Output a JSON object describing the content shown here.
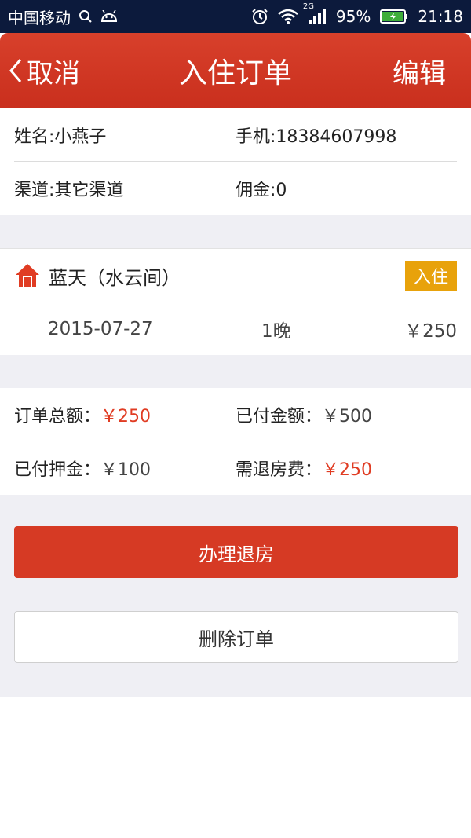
{
  "status_bar": {
    "carrier": "中国移动",
    "network": "2G",
    "battery": "95%",
    "time": "21:18"
  },
  "nav": {
    "back_label": "取消",
    "title": "入住订单",
    "edit_label": "编辑"
  },
  "guest": {
    "name": "姓名:小燕子",
    "phone": "手机:18384607998",
    "channel": "渠道:其它渠道",
    "commission": "佣金:0"
  },
  "room": {
    "name": "蓝天（水云间）",
    "status": "入住",
    "date": "2015-07-27",
    "nights": "1晚",
    "price": "￥250"
  },
  "payment": {
    "total_label": "订单总额：",
    "total_value": "￥250",
    "paid_label": "已付金额：",
    "paid_value": "￥500",
    "deposit_label": "已付押金：",
    "deposit_value": "￥100",
    "refund_label": "需退房费：",
    "refund_value": "￥250"
  },
  "actions": {
    "checkout_label": "办理退房",
    "delete_label": "删除订单"
  },
  "colors": {
    "accent_red": "#d63a24",
    "badge_orange": "#e8a20b",
    "status_bar_bg": "#0c1a3c"
  }
}
